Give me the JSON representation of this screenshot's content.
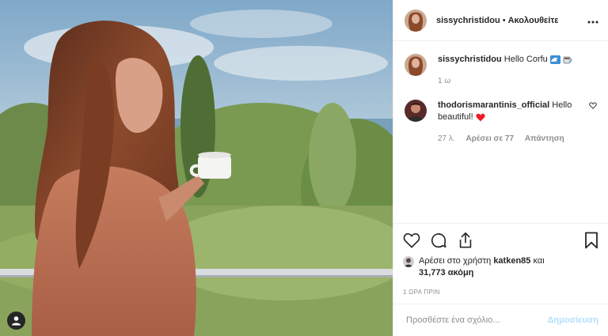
{
  "colors": {
    "text": "#262626",
    "muted": "#8e8e8e",
    "border": "#efefef",
    "post_button_disabled": "#b2dffc",
    "heart_red": "#ed1c24"
  },
  "photo": {
    "description_icons": [
      "user-tag-icon"
    ]
  },
  "header": {
    "username": "sissychristidou",
    "separator": "•",
    "follow_label": "Ακολουθείτε",
    "more_icon": "more-options-icon"
  },
  "caption": {
    "username": "sissychristidou",
    "text": "Hello Corfu",
    "emojis": [
      "wave-emoji",
      "coffee-emoji"
    ],
    "age": "1 ω"
  },
  "comments": [
    {
      "username": "thodorismarantinis_official",
      "text": "Hello beautiful!",
      "emoji": "red-heart-emoji",
      "age": "27 λ.",
      "likes": "Αρέσει σε 77",
      "reply": "Απάντηση"
    }
  ],
  "likes": {
    "prefix": "Αρέσει στο χρήστη",
    "user": "katken85",
    "and": "και",
    "count": "31,773 ακόμη"
  },
  "timestamp": "1 ΩΡΑ ΠΡΙΝ",
  "add_comment": {
    "placeholder": "Προσθέστε ένα σχόλιο...",
    "post_label": "Δημοσίευση"
  }
}
